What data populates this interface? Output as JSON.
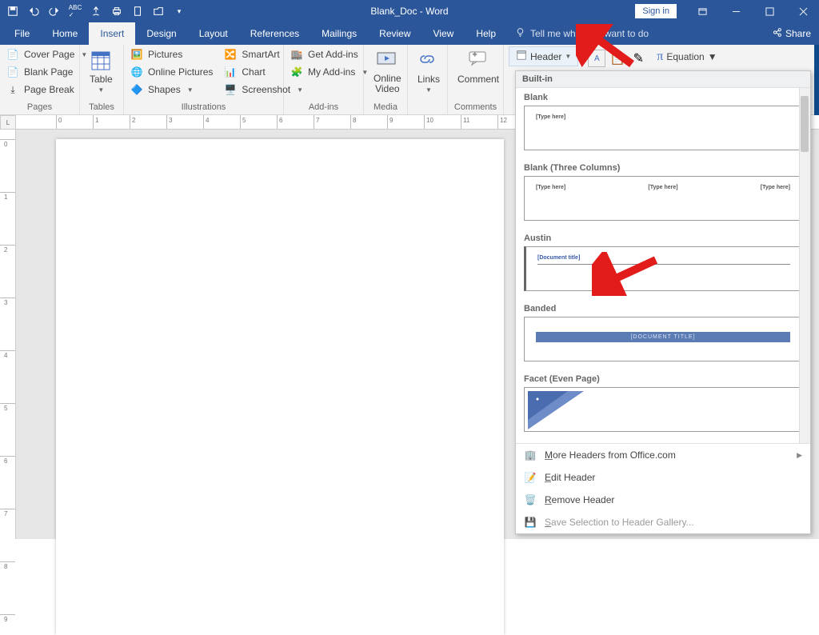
{
  "titlebar": {
    "title": "Blank_Doc - Word",
    "signin": "Sign in"
  },
  "tabs": {
    "file": "File",
    "home": "Home",
    "insert": "Insert",
    "design": "Design",
    "layout": "Layout",
    "references": "References",
    "mailings": "Mailings",
    "review": "Review",
    "view": "View",
    "help": "Help",
    "tellme": "Tell me what you want to do",
    "share": "Share"
  },
  "ribbon": {
    "pages": {
      "cover": "Cover Page",
      "blank": "Blank Page",
      "break": "Page Break",
      "label": "Pages"
    },
    "tables": {
      "table": "Table",
      "label": "Tables"
    },
    "illustrations": {
      "pictures": "Pictures",
      "online_pictures": "Online Pictures",
      "shapes": "Shapes",
      "smartart": "SmartArt",
      "chart": "Chart",
      "screenshot": "Screenshot",
      "label": "Illustrations"
    },
    "addins": {
      "get": "Get Add-ins",
      "my": "My Add-ins",
      "label": "Add-ins"
    },
    "media": {
      "online_video": "Online\nVideo",
      "label": "Media"
    },
    "links": {
      "links": "Links",
      "label": ""
    },
    "comments": {
      "comment": "Comment",
      "label": "Comments"
    },
    "headerfooter": {
      "header": "Header"
    },
    "equation": "Equation"
  },
  "dropdown": {
    "section": "Built-in",
    "items": {
      "blank": {
        "name": "Blank",
        "placeholder": "[Type here]"
      },
      "three": {
        "name": "Blank (Three Columns)",
        "placeholder": "[Type here]"
      },
      "austin": {
        "name": "Austin",
        "placeholder": "[Document title]"
      },
      "banded": {
        "name": "Banded",
        "placeholder": "[DOCUMENT TITLE]"
      },
      "facet": {
        "name": "Facet (Even Page)"
      }
    },
    "menu": {
      "more": "More Headers from Office.com",
      "edit": "Edit Header",
      "remove": "Remove Header",
      "save": "Save Selection to Header Gallery..."
    }
  },
  "ruler": {
    "corner": "L"
  }
}
